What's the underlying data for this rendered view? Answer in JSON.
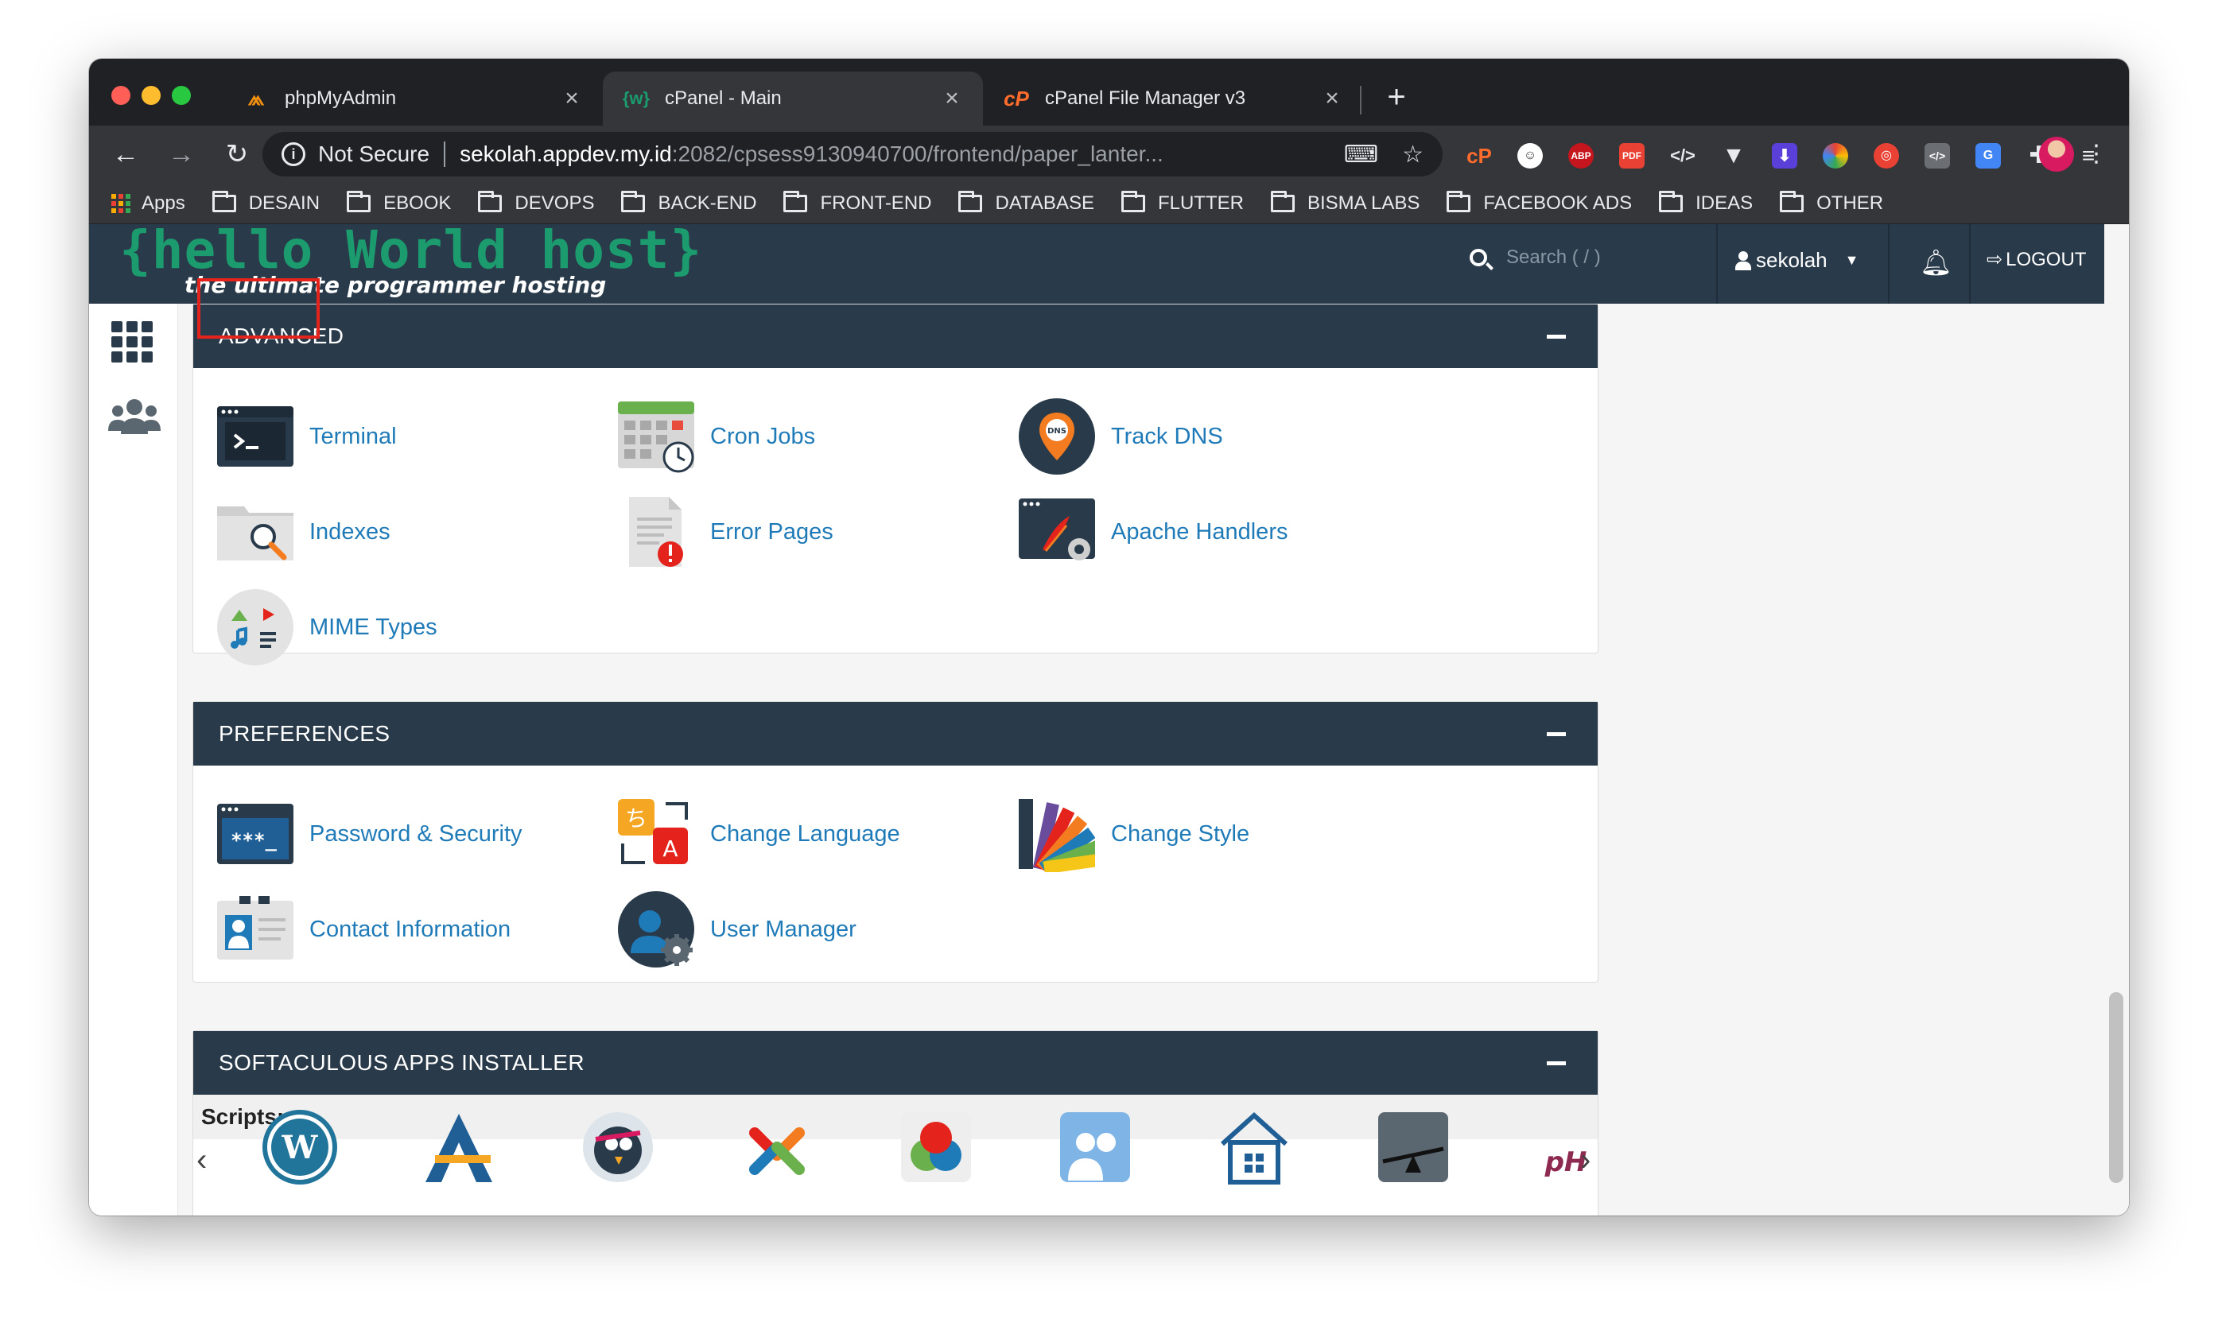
{
  "browser": {
    "tabs": [
      {
        "label": "phpMyAdmin",
        "icon": "phpmyadmin-icon",
        "active": false
      },
      {
        "label": "cPanel - Main",
        "icon": "cpanel-tab-icon",
        "active": true
      },
      {
        "label": "cPanel File Manager v3",
        "icon": "cpanel-logo-icon",
        "active": false
      }
    ],
    "new_tab": "+",
    "close_glyph": "×",
    "security_label": "Not Secure",
    "url_host": "sekolah.appdev.my.id",
    "url_path": ":2082/cpsess9130940700/frontend/paper_lanter...",
    "bookmarks": [
      "Apps",
      "DESAIN",
      "EBOOK",
      "DEVOPS",
      "BACK-END",
      "FRONT-END",
      "DATABASE",
      "FLUTTER",
      "BISMA LABS",
      "FACEBOOK ADS",
      "IDEAS",
      "OTHER"
    ]
  },
  "cpanel": {
    "logo_main": "{hello World host}",
    "logo_sub": "the ultimate programmer hosting",
    "search_placeholder": "Search ( / )",
    "username": "sekolah",
    "logout_label": "LOGOUT",
    "accent": "#1f7ab8",
    "header_bg": "#293a4a",
    "highlight_color": "#e3231c"
  },
  "sections": {
    "advanced": {
      "title": "ADVANCED",
      "items": [
        "Terminal",
        "Cron Jobs",
        "Track DNS",
        "Indexes",
        "Error Pages",
        "Apache Handlers",
        "MIME Types"
      ]
    },
    "preferences": {
      "title": "PREFERENCES",
      "items": [
        "Password & Security",
        "Change Language",
        "Change Style",
        "Contact Information",
        "User Manager"
      ]
    },
    "softaculous": {
      "title": "SOFTACULOUS APPS INSTALLER",
      "scripts_label": "Scripts:",
      "script_icons": [
        "wordpress-icon",
        "abantecart-icon",
        "prestashop-icon",
        "joomla-icon",
        "opencart-icon",
        "users-app-icon",
        "house-icon",
        "seesaw-icon",
        "phpbb-icon"
      ]
    }
  }
}
